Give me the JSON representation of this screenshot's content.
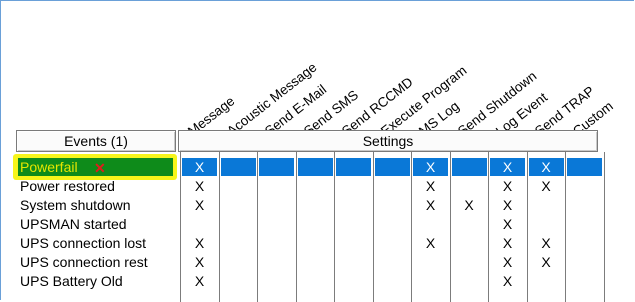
{
  "columns": [
    "Message",
    "Acoustic Message",
    "Send E-Mail",
    "Send SMS",
    "Send RCCMD",
    "Execute Program",
    "MS Log",
    "Send Shutdown",
    "Log Event",
    "Send TRAP",
    "Custom"
  ],
  "events_header": "Events (1)",
  "settings_header": "Settings",
  "events": [
    {
      "label": "Powerfail",
      "selected": true,
      "cells": [
        "X",
        "",
        "",
        "",
        "",
        "",
        "X",
        "",
        "X",
        "X",
        ""
      ]
    },
    {
      "label": "Power restored",
      "selected": false,
      "cells": [
        "X",
        "",
        "",
        "",
        "",
        "",
        "X",
        "",
        "X",
        "X",
        ""
      ]
    },
    {
      "label": "System shutdown",
      "selected": false,
      "cells": [
        "X",
        "",
        "",
        "",
        "",
        "",
        "X",
        "X",
        "X",
        "",
        ""
      ]
    },
    {
      "label": "UPSMAN started",
      "selected": false,
      "cells": [
        "",
        "",
        "",
        "",
        "",
        "",
        "",
        "",
        "X",
        "",
        ""
      ]
    },
    {
      "label": "UPS connection lost",
      "selected": false,
      "cells": [
        "X",
        "",
        "",
        "",
        "",
        "",
        "X",
        "",
        "X",
        "X",
        ""
      ]
    },
    {
      "label": "UPS connection rest",
      "selected": false,
      "cells": [
        "X",
        "",
        "",
        "",
        "",
        "",
        "",
        "",
        "X",
        "X",
        ""
      ]
    },
    {
      "label": "UPS Battery Old",
      "selected": false,
      "cells": [
        "X",
        "",
        "",
        "",
        "",
        "",
        "",
        "",
        "X",
        "",
        ""
      ]
    }
  ],
  "selected_mark": "✕",
  "colors": {
    "selection_blue": "#0a78d7",
    "selection_green": "#0e8b1a",
    "highlight_yellow": "#f7f51a",
    "annotation_red": "#e21b1b"
  }
}
